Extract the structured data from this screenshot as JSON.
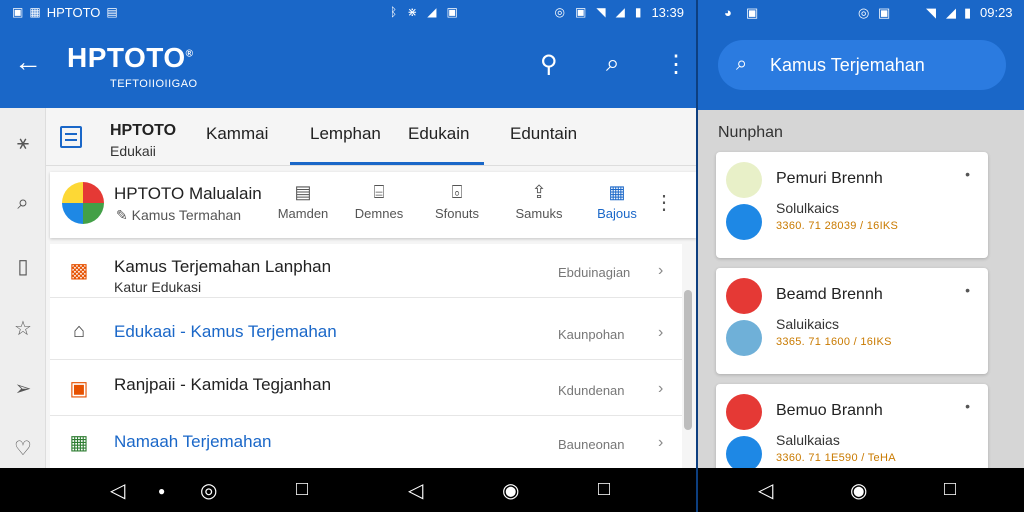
{
  "left": {
    "status": {
      "app_label": "HPTOTO",
      "time": "13:39"
    },
    "appbar": {
      "logo": "HPTOTO",
      "logo_mark": "®",
      "subtitle": "TEFTOIIOIIGAO"
    },
    "tabs": {
      "brand_title": "HPTOTO",
      "brand_sub": "Edukaii",
      "items": [
        "Kammai",
        "Lemphan",
        "Edukain",
        "Eduntain"
      ],
      "active_index": 1
    },
    "card": {
      "title": "HPTOTO Malualain",
      "subtitle": "Kamus Termahan",
      "actions": [
        {
          "label": "Mamden",
          "icon": "document-icon"
        },
        {
          "label": "Demnes",
          "icon": "folder-icon"
        },
        {
          "label": "Sfonuts",
          "icon": "bag-icon"
        },
        {
          "label": "Samuks",
          "icon": "share-icon"
        },
        {
          "label": "Bajous",
          "icon": "grid-icon"
        }
      ],
      "active_action": 4
    },
    "list": [
      {
        "title": "Kamus Terjemahan Lanphan",
        "sub": "Katur Edukasi",
        "right": "Ebduinagian",
        "blue": false,
        "icon": "briefcase-icon"
      },
      {
        "title": "Edukaai - Kamus Terjemahan",
        "sub": "",
        "right": "Kaunpohan",
        "blue": true,
        "icon": "home-icon"
      },
      {
        "title": "Ranjpaii - Kamida Tegjanhan",
        "sub": "",
        "right": "Kdundenan",
        "blue": false,
        "icon": "folder-check-icon"
      },
      {
        "title": "Namaah Terjemahan",
        "sub": "",
        "right": "Bauneonan",
        "blue": true,
        "icon": "calendar-icon"
      }
    ]
  },
  "right": {
    "status": {
      "time": "09:23"
    },
    "search": {
      "text": "Kamus Terjemahan"
    },
    "section": "Nunphan",
    "cards": [
      {
        "name": "Pemuri Brennh",
        "label": "Solulkaics",
        "meta": "3360. 71 28039 / 16IKS",
        "c1": "#e8f0c8",
        "c2": "#1e88e5"
      },
      {
        "name": "Beamd Brennh",
        "label": "Saluikaics",
        "meta": "3365. 71 1600 / 16IKS",
        "c1": "#e53935",
        "c2": "#6fb0d8"
      },
      {
        "name": "Bemuo Brannh",
        "label": "Salulkaias",
        "meta": "3360. 71 1E590 / TeHA",
        "c1": "#e53935",
        "c2": "#1e88e5"
      }
    ]
  }
}
